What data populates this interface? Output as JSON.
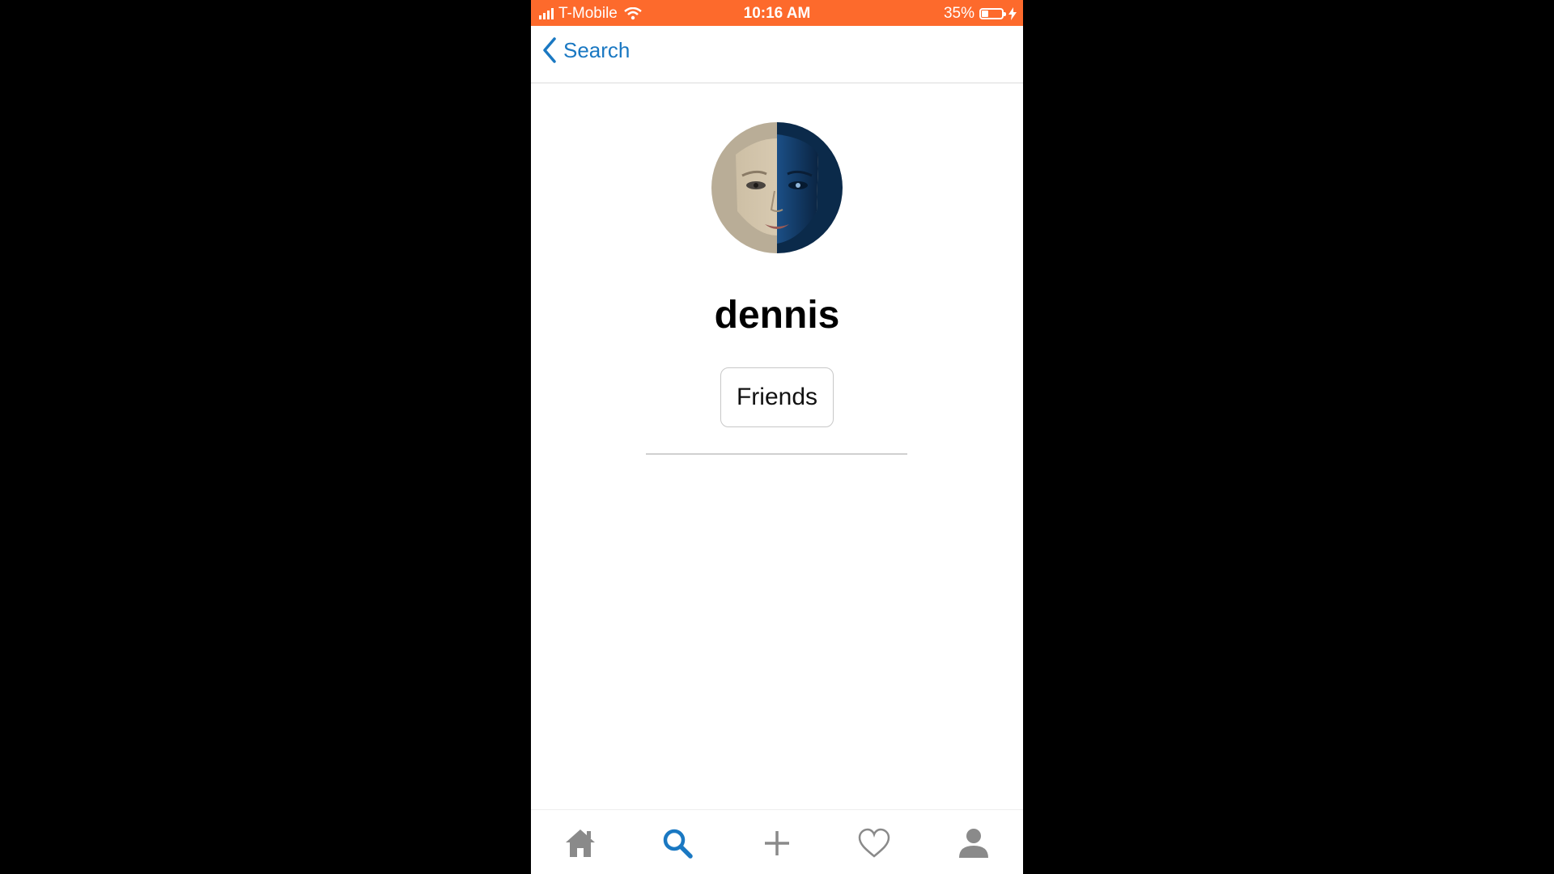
{
  "status_bar": {
    "carrier": "T-Mobile",
    "time": "10:16 AM",
    "battery": "35%",
    "battery_level": 0.35
  },
  "nav": {
    "back_label": "Search"
  },
  "profile": {
    "username": "dennis",
    "friends_label": "Friends"
  },
  "tab_bar": {
    "tabs": [
      {
        "icon": "home-icon",
        "active": false
      },
      {
        "icon": "search-icon",
        "active": true
      },
      {
        "icon": "plus-icon",
        "active": false
      },
      {
        "icon": "heart-icon",
        "active": false
      },
      {
        "icon": "person-icon",
        "active": false
      }
    ]
  },
  "colors": {
    "status_bar": "#fd6a2c",
    "accent": "#1a78c2",
    "inactive_icon": "#8a8a8a"
  }
}
